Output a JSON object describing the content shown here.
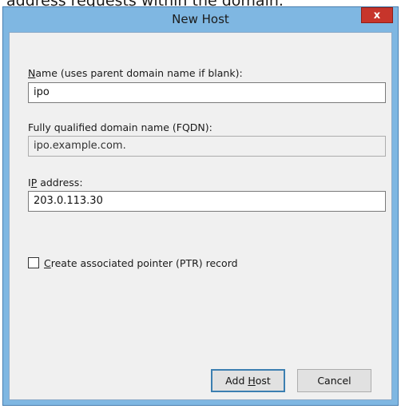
{
  "background": {
    "text": "address requests within the domain."
  },
  "dialog": {
    "title": "New Host",
    "close_label": "x",
    "name": {
      "label_prefix": "",
      "label_mnemonic": "N",
      "label_rest": "ame (uses parent domain name if blank):",
      "value": "ipo"
    },
    "fqdn": {
      "label": "Fully qualified domain name (FQDN):",
      "value": "ipo.example.com."
    },
    "ip": {
      "label_prefix": "I",
      "label_mnemonic": "P",
      "label_rest": " address:",
      "value": "203.0.113.30"
    },
    "ptr": {
      "label_prefix": "",
      "label_mnemonic": "C",
      "label_rest": "reate associated pointer (PTR) record",
      "checked": false
    },
    "buttons": {
      "add_prefix": "Add ",
      "add_mnemonic": "H",
      "add_rest": "ost",
      "cancel": "Cancel"
    }
  },
  "colors": {
    "title_bar": "#7fb7e2",
    "client": "#f0f0f0",
    "close_button": "#c7352b",
    "default_button_border": "#3c7fb1"
  }
}
